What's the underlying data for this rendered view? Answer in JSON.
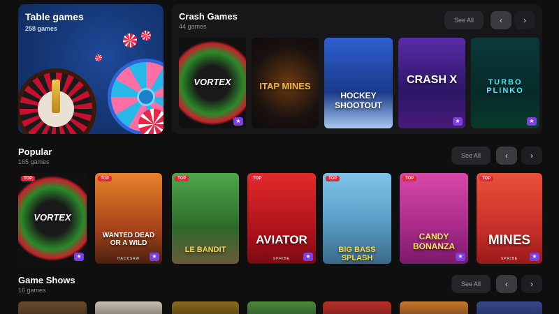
{
  "table_games": {
    "title": "Table games",
    "count": "258 games"
  },
  "crash": {
    "title": "Crash Games",
    "count": "44 games",
    "see_all": "See All",
    "tiles": [
      {
        "name": "VORTEX"
      },
      {
        "name": "ITAP MINES"
      },
      {
        "name": "HOCKEY SHOOTOUT"
      },
      {
        "name": "CRASH X"
      },
      {
        "name": "TURBO PLINKO"
      }
    ]
  },
  "popular": {
    "title": "Popular",
    "count": "165 games",
    "see_all": "See All",
    "badge": "TOP",
    "tiles": [
      {
        "name": "VORTEX",
        "provider": ""
      },
      {
        "name": "WANTED DEAD OR A WILD",
        "provider": "HACKSAW"
      },
      {
        "name": "LE BANDIT",
        "provider": ""
      },
      {
        "name": "AVIATOR",
        "provider": "SPRIBE"
      },
      {
        "name": "BIG BASS SPLASH",
        "provider": ""
      },
      {
        "name": "CANDY BONANZA",
        "provider": ""
      },
      {
        "name": "MINES",
        "provider": "SPRIBE"
      }
    ]
  },
  "game_shows": {
    "title": "Game Shows",
    "count": "16 games",
    "see_all": "See All"
  },
  "icons": {
    "prev": "chevron-left-icon",
    "next": "chevron-right-icon",
    "trophy": "trophy-icon"
  }
}
